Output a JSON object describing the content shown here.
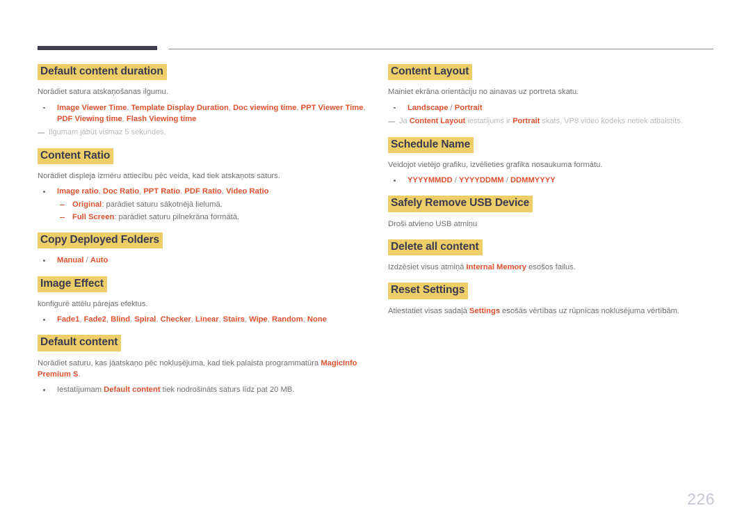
{
  "document": {
    "page_number": "226",
    "accent_heading_bg": "#edce68",
    "accent_heading_text": "#3b3a4e",
    "accent_term": "#e0512f",
    "body_text_color": "#6f7073",
    "rule_thick_color": "#3f3a4e",
    "rule_thin_color": "#8a8a90"
  },
  "left_column": {
    "sections": [
      {
        "heading": "Default content duration",
        "intro": "Norādiet satura atskaņošanas ilgumu.",
        "bullets": [
          {
            "parts": [
              {
                "text": "Image Viewer Time",
                "style": "term"
              },
              {
                "text": ", ",
                "style": "sep"
              },
              {
                "text": "Template Display Duration",
                "style": "term"
              },
              {
                "text": ", ",
                "style": "sep"
              },
              {
                "text": "Doc viewing time",
                "style": "term"
              },
              {
                "text": ", ",
                "style": "sep"
              },
              {
                "text": "PPT Viewer Time",
                "style": "term"
              },
              {
                "text": ", ",
                "style": "sep"
              },
              {
                "text": "PDF Viewing time",
                "style": "term"
              },
              {
                "text": ", ",
                "style": "sep"
              },
              {
                "text": "Flash Viewing time",
                "style": "term"
              }
            ]
          }
        ],
        "note": "Ilgumam jābūt vismaz 5 sekundes."
      },
      {
        "heading": "Content Ratio",
        "intro": "Norādiet displeja izmēru attiecību pēc veida, kad tiek atskaņots saturs.",
        "bullets": [
          {
            "parts": [
              {
                "text": "Image ratio",
                "style": "term"
              },
              {
                "text": ", ",
                "style": "sep"
              },
              {
                "text": "Doc Ratio",
                "style": "term"
              },
              {
                "text": ", ",
                "style": "sep"
              },
              {
                "text": "PPT Ratio",
                "style": "term"
              },
              {
                "text": ", ",
                "style": "sep"
              },
              {
                "text": "PDF Ratio",
                "style": "term"
              },
              {
                "text": ", ",
                "style": "sep"
              },
              {
                "text": "Video Ratio",
                "style": "term"
              }
            ],
            "sub": [
              {
                "parts": [
                  {
                    "text": "Original",
                    "style": "term"
                  },
                  {
                    "text": ": parādiet saturu sākotnējā lielumā.",
                    "style": "plain"
                  }
                ]
              },
              {
                "parts": [
                  {
                    "text": "Full Screen",
                    "style": "term"
                  },
                  {
                    "text": ": parādiet saturu pilnekrāna formātā.",
                    "style": "plain"
                  }
                ]
              }
            ]
          }
        ]
      },
      {
        "heading": "Copy Deployed Folders",
        "bullets": [
          {
            "parts": [
              {
                "text": "Manual",
                "style": "term"
              },
              {
                "text": " / ",
                "style": "sep"
              },
              {
                "text": "Auto",
                "style": "term"
              }
            ]
          }
        ]
      },
      {
        "heading": "Image Effect",
        "intro": "konfigurē attēlu pārejas efektus.",
        "bullets": [
          {
            "parts": [
              {
                "text": "Fade1",
                "style": "term"
              },
              {
                "text": ", ",
                "style": "sep"
              },
              {
                "text": "Fade2",
                "style": "term"
              },
              {
                "text": ", ",
                "style": "sep"
              },
              {
                "text": "Blind",
                "style": "term"
              },
              {
                "text": ", ",
                "style": "sep"
              },
              {
                "text": "Spiral",
                "style": "term"
              },
              {
                "text": ", ",
                "style": "sep"
              },
              {
                "text": "Checker",
                "style": "term"
              },
              {
                "text": ", ",
                "style": "sep"
              },
              {
                "text": "Linear",
                "style": "term"
              },
              {
                "text": ", ",
                "style": "sep"
              },
              {
                "text": "Stairs",
                "style": "term"
              },
              {
                "text": ", ",
                "style": "sep"
              },
              {
                "text": "Wipe",
                "style": "term"
              },
              {
                "text": ", ",
                "style": "sep"
              },
              {
                "text": "Random",
                "style": "term"
              },
              {
                "text": ", ",
                "style": "sep"
              },
              {
                "text": "None",
                "style": "term"
              }
            ]
          }
        ]
      },
      {
        "heading": "Default content",
        "intro_parts": [
          {
            "text": "Norādiet saturu, kas jāatskaņo pēc noklusējuma, kad tiek palaista programmatūra ",
            "style": "plain"
          },
          {
            "text": "MagicInfo Premium S",
            "style": "term"
          },
          {
            "text": ".",
            "style": "plain"
          }
        ],
        "bullets": [
          {
            "parts": [
              {
                "text": "Iestatījumam ",
                "style": "plain"
              },
              {
                "text": "Default content",
                "style": "term"
              },
              {
                "text": " tiek nodrošināts saturs līdz pat 20 MB.",
                "style": "plain"
              }
            ]
          }
        ]
      }
    ]
  },
  "right_column": {
    "sections": [
      {
        "heading": "Content Layout",
        "intro": "Mainiet ekrāna orientāciju no ainavas uz portreta skatu.",
        "bullets": [
          {
            "parts": [
              {
                "text": "Landscape",
                "style": "term"
              },
              {
                "text": " / ",
                "style": "sep"
              },
              {
                "text": "Portrait",
                "style": "term"
              }
            ]
          }
        ],
        "note_parts": [
          {
            "text": "Ja ",
            "style": "plain"
          },
          {
            "text": "Content Layout",
            "style": "term-note"
          },
          {
            "text": " iestatījums ir ",
            "style": "plain"
          },
          {
            "text": "Portrait",
            "style": "term-note"
          },
          {
            "text": " skats, VP8 video kodeks netiek atbalstīts.",
            "style": "plain"
          }
        ]
      },
      {
        "heading": "Schedule Name",
        "intro": "Veidojot vietējo grafiku, izvēlieties grafika nosaukuma formātu.",
        "bullets": [
          {
            "parts": [
              {
                "text": "YYYYMMDD",
                "style": "term"
              },
              {
                "text": " / ",
                "style": "sep"
              },
              {
                "text": "YYYYDDMM",
                "style": "term"
              },
              {
                "text": " / ",
                "style": "sep"
              },
              {
                "text": "DDMMYYYY",
                "style": "term"
              }
            ]
          }
        ]
      },
      {
        "heading": "Safely Remove USB Device",
        "intro": "Droši atvieno USB atmiņu"
      },
      {
        "heading": "Delete all content",
        "intro_parts": [
          {
            "text": "Izdzēsiet visus atmiņā ",
            "style": "plain"
          },
          {
            "text": "Internal Memory",
            "style": "term"
          },
          {
            "text": " esošos failus.",
            "style": "plain"
          }
        ]
      },
      {
        "heading": "Reset Settings",
        "intro_parts": [
          {
            "text": "Atiestatiet visas sadaļā ",
            "style": "plain"
          },
          {
            "text": "Settings",
            "style": "term"
          },
          {
            "text": " esošās vērtības uz rūpnīcas noklusējuma vērtībām.",
            "style": "plain"
          }
        ]
      }
    ]
  }
}
